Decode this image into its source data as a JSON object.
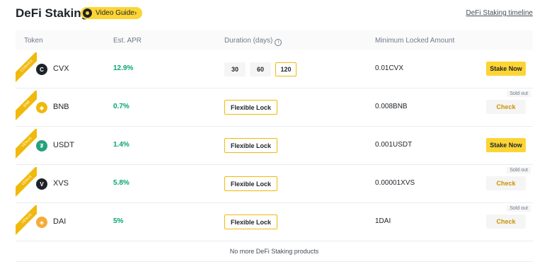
{
  "header": {
    "title": "DeFi Staking",
    "video_guide": "Video Guide›",
    "timeline_link": "DeFi Staking timeline"
  },
  "table": {
    "columns": [
      "Token",
      "Est. APR",
      "Duration (days)",
      "Minimum Locked Amount"
    ],
    "info_icon": "i",
    "rows": [
      {
        "ribbon": "CONVEX",
        "token": "CVX",
        "icon": "C",
        "icon_color": "#1e2329",
        "apr": "12.9%",
        "durations": [
          "30",
          "60",
          "120"
        ],
        "selected_duration": "120",
        "min": "0.01CVX",
        "action": "Stake Now",
        "sold_out": ""
      },
      {
        "ribbon": "BNB",
        "token": "BNB",
        "icon": "◆",
        "icon_color": "#f0b90b",
        "apr": "0.7%",
        "lock": "Flexible Lock",
        "min": "0.008BNB",
        "action": "Check",
        "sold_out": "Sold out"
      },
      {
        "ribbon": "VENUS",
        "token": "USDT",
        "icon": "₮",
        "icon_color": "#26a17b",
        "apr": "1.4%",
        "lock": "Flexible Lock",
        "min": "0.001USDT",
        "action": "Stake Now",
        "sold_out": ""
      },
      {
        "ribbon": "VENUS",
        "token": "XVS",
        "icon": "V",
        "icon_color": "#1e2329",
        "apr": "5.8%",
        "lock": "Flexible Lock",
        "min": "0.00001XVS",
        "action": "Check",
        "sold_out": "Sold out"
      },
      {
        "ribbon": "VENUS",
        "token": "DAI",
        "icon": "◈",
        "icon_color": "#f5ac37",
        "apr": "5%",
        "lock": "Flexible Lock",
        "min": "1DAI",
        "action": "Check",
        "sold_out": "Sold out"
      }
    ],
    "footer": "No more DeFi Staking products"
  },
  "colors": {
    "accent": "#fcd535",
    "positive": "#03a66d",
    "link_check": "#c99400"
  }
}
